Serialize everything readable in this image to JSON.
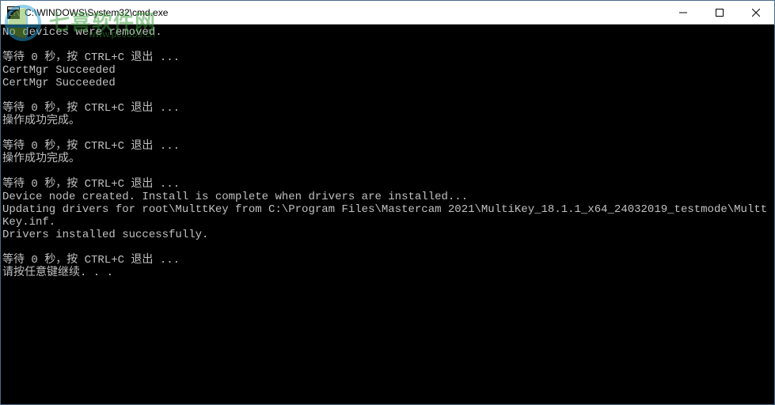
{
  "window": {
    "title": "C:\\WINDOWS\\System32\\cmd.exe"
  },
  "terminal": {
    "lines": [
      "No devices were removed.",
      "",
      "等待 0 秒，按 CTRL+C 退出 ...",
      "CertMgr Succeeded",
      "CertMgr Succeeded",
      "",
      "等待 0 秒，按 CTRL+C 退出 ...",
      "操作成功完成。",
      "",
      "等待 0 秒，按 CTRL+C 退出 ...",
      "操作成功完成。",
      "",
      "等待 0 秒，按 CTRL+C 退出 ...",
      "Device node created. Install is complete when drivers are installed...",
      "Updating drivers for root\\MulttKey from C:\\Program Files\\Mastercam 2021\\MultiKey_18.1.1_x64_24032019_testmode\\MulttKey.inf.",
      "Drivers installed successfully.",
      "",
      "等待 0 秒，按 CTRL+C 退出 ...",
      "请按任意键继续. . ."
    ]
  },
  "watermark": {
    "main": "七喜软件网",
    "sub": "www.pc0359.cn"
  }
}
